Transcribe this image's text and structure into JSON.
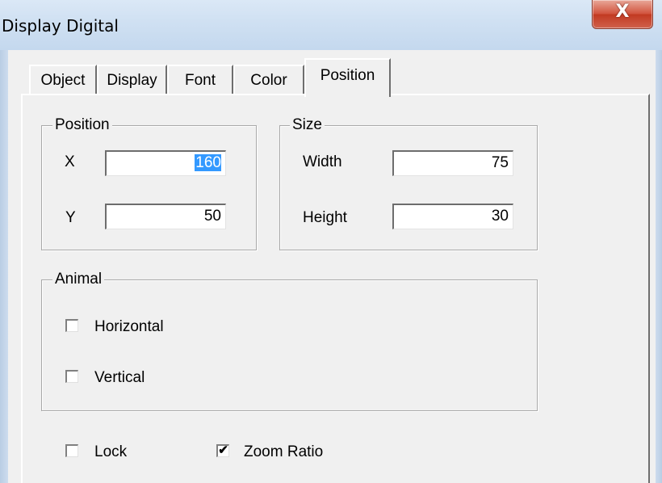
{
  "window": {
    "title": "Display Digital",
    "close_icon": "X"
  },
  "tabs": [
    {
      "label": "Object",
      "active": false
    },
    {
      "label": "Display",
      "active": false
    },
    {
      "label": "Font",
      "active": false
    },
    {
      "label": "Color",
      "active": false
    },
    {
      "label": "Position",
      "active": true
    }
  ],
  "position_group": {
    "title": "Position",
    "x_label": "X",
    "x_value_selected": "160",
    "y_label": "Y",
    "y_value": "50"
  },
  "size_group": {
    "title": "Size",
    "width_label": "Width",
    "width_value": "75",
    "height_label": "Height",
    "height_value": "30"
  },
  "animal_group": {
    "title": "Animal",
    "horizontal_label": "Horizontal",
    "horizontal_checked": false,
    "vertical_label": "Vertical",
    "vertical_checked": false
  },
  "options": {
    "lock_label": "Lock",
    "lock_checked": false,
    "zoom_label": "Zoom Ratio",
    "zoom_checked": true,
    "check_glyph": "✔"
  }
}
